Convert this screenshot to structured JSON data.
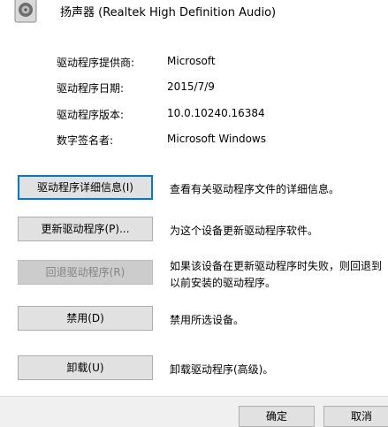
{
  "device": {
    "title": "扬声器 (Realtek High Definition Audio)",
    "icon": "speaker-icon"
  },
  "info": [
    {
      "label": "驱动程序提供商:",
      "value": "Microsoft"
    },
    {
      "label": "驱动程序日期:",
      "value": "2015/7/9"
    },
    {
      "label": "驱动程序版本:",
      "value": "10.0.10240.16384"
    },
    {
      "label": "数字签名者:",
      "value": "Microsoft Windows"
    }
  ],
  "actions": [
    {
      "label": "驱动程序详细信息(I)",
      "desc": "查看有关驱动程序文件的详细信息。"
    },
    {
      "label": "更新驱动程序(P)...",
      "desc": "为这个设备更新驱动程序软件。"
    },
    {
      "label": "回退驱动程序(R)",
      "desc": "如果该设备在更新驱动程序时失败，则回退到以前安装的驱动程序。"
    },
    {
      "label": "禁用(D)",
      "desc": "禁用所选设备。"
    },
    {
      "label": "卸载(U)",
      "desc": "卸载驱动程序(高级)。"
    }
  ],
  "footer": {
    "ok_label": "确定",
    "cancel_label": "取消"
  },
  "colors": {
    "focus_border": "#0078d7",
    "disabled_text": "#838383"
  }
}
